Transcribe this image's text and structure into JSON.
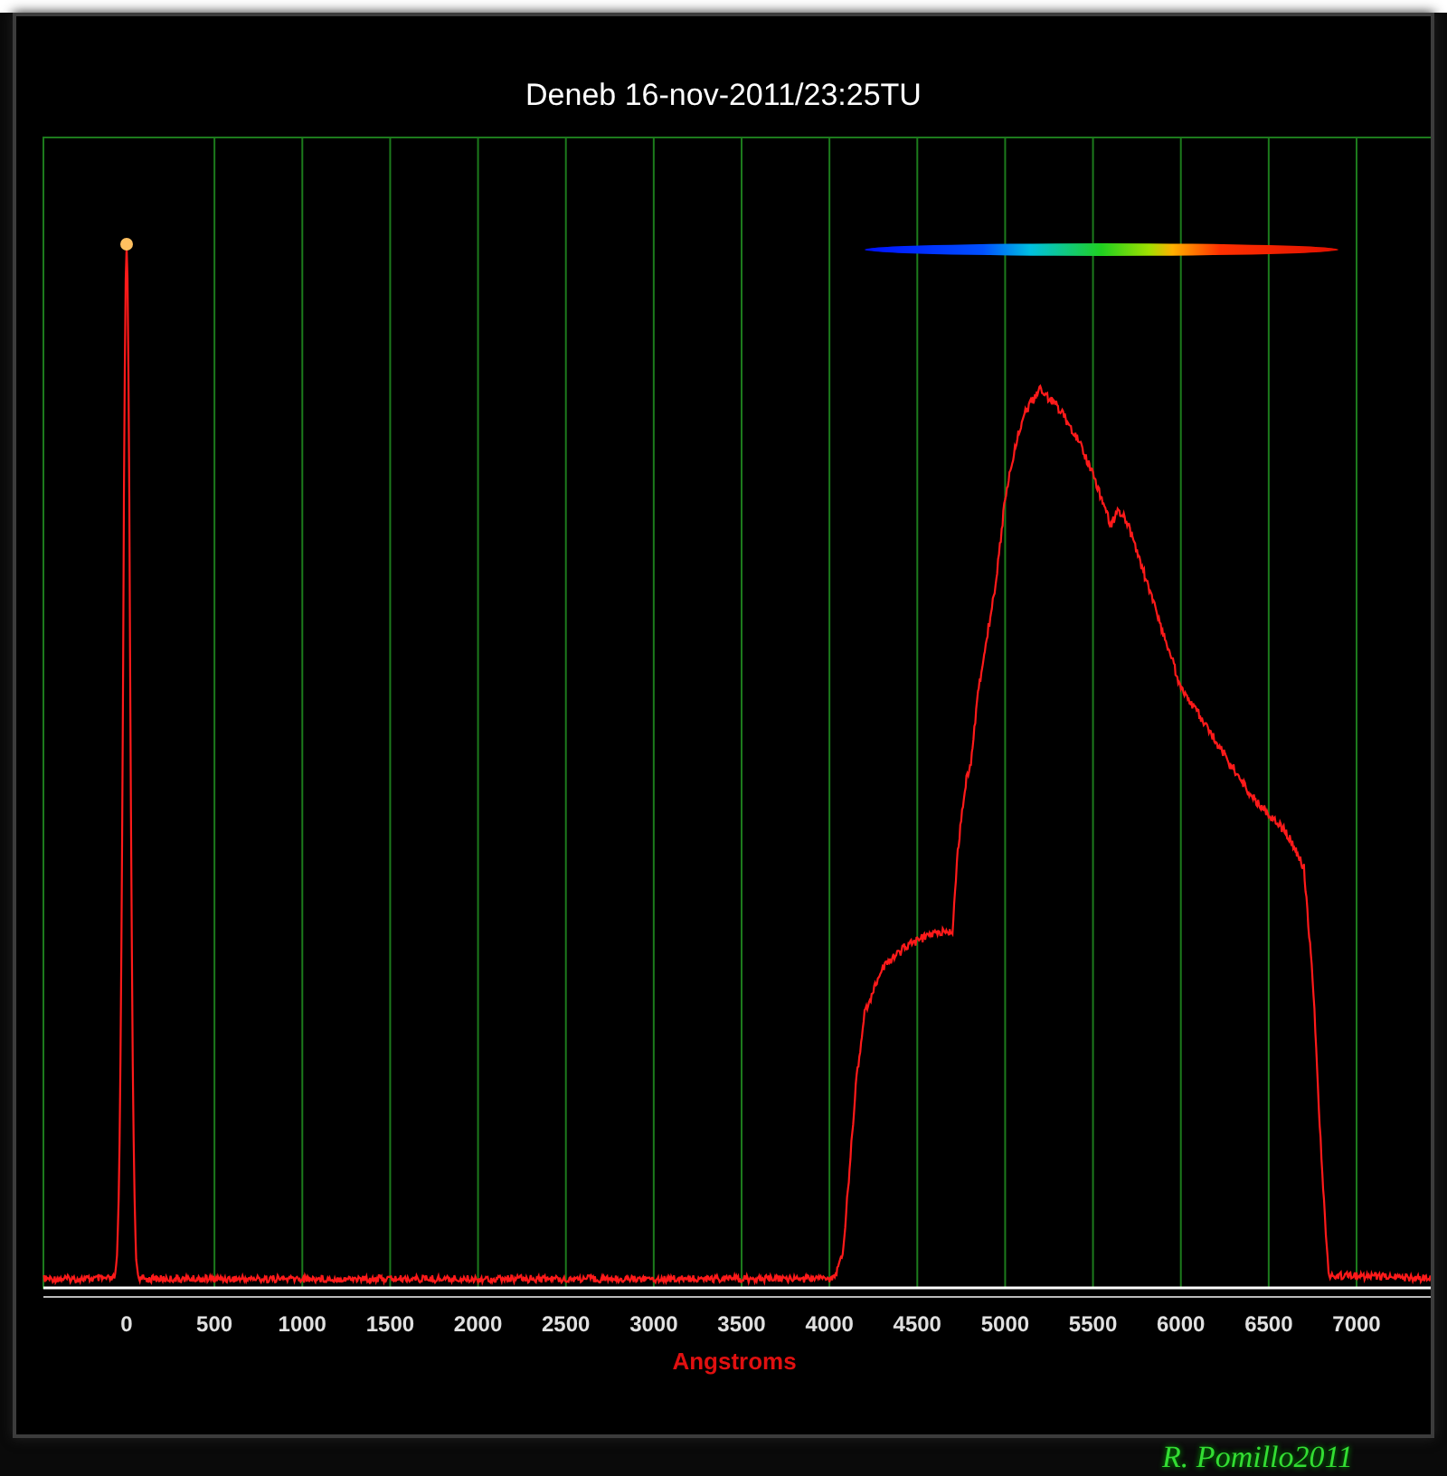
{
  "chart": {
    "title": "Deneb 16-nov-2011/23:25TU",
    "x_axis": {
      "ticks": [
        "0",
        "500",
        "1000",
        "1500",
        "2000",
        "2500",
        "3000",
        "3500",
        "4000",
        "4500",
        "5000",
        "5500",
        "6000",
        "6500",
        "7000"
      ],
      "label": "Angstroms"
    }
  },
  "signature": "R. Pomillo2011"
}
